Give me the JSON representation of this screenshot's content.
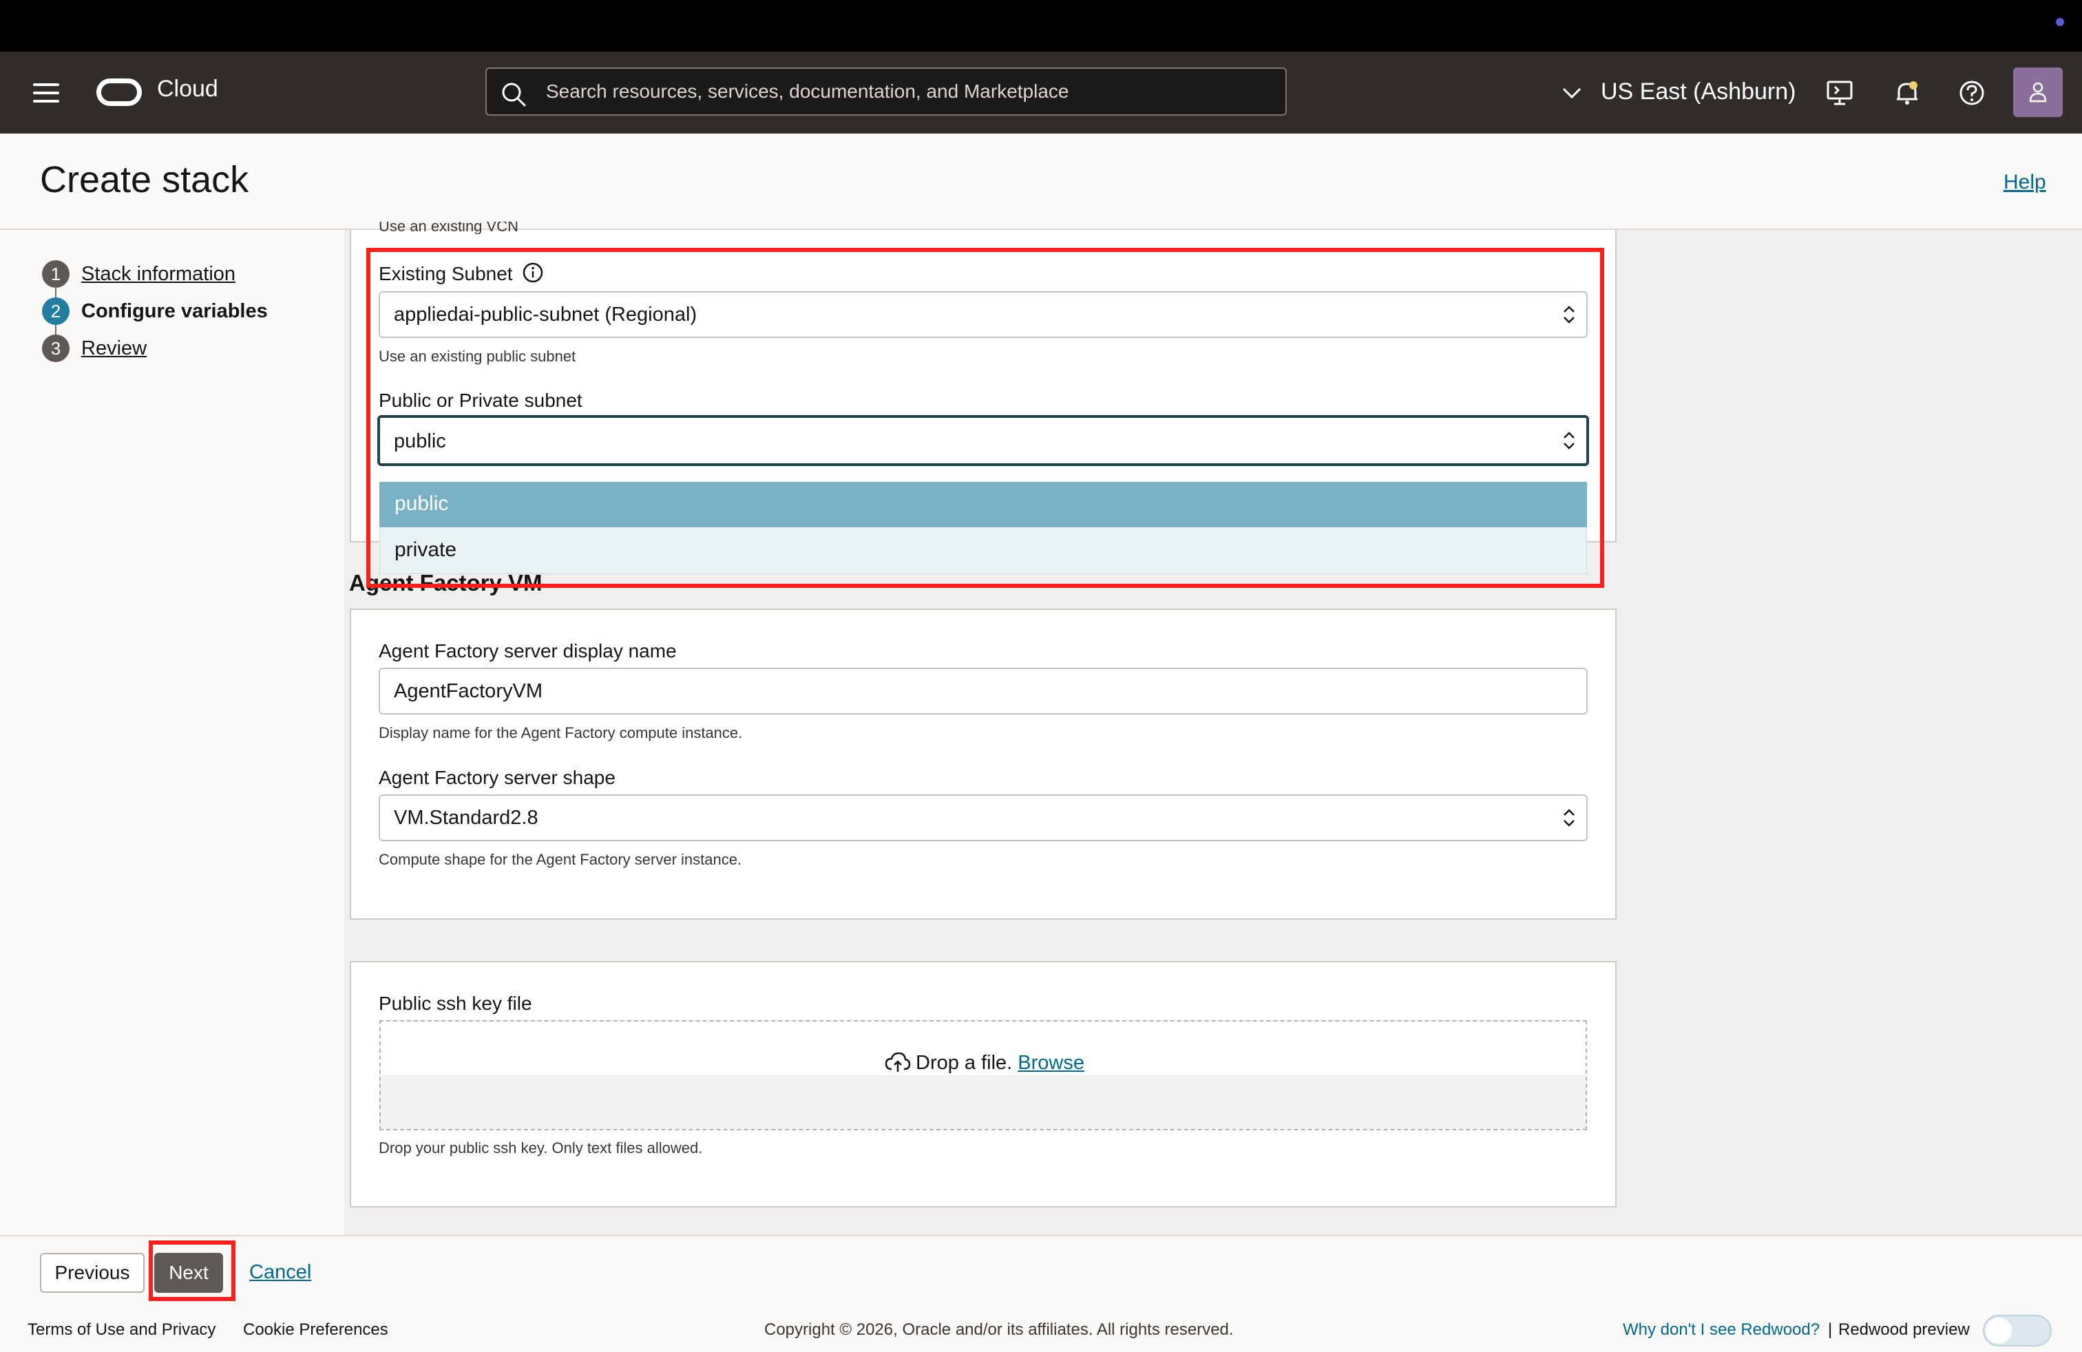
{
  "header": {
    "brand": "Cloud",
    "search_placeholder": "Search resources, services, documentation, and Marketplace",
    "region": "US East (Ashburn)"
  },
  "page": {
    "title": "Create stack",
    "help": "Help"
  },
  "steps": [
    {
      "num": "1",
      "label": "Stack information",
      "state": "done"
    },
    {
      "num": "2",
      "label": "Configure variables",
      "state": "current"
    },
    {
      "num": "3",
      "label": "Review",
      "state": "todo"
    }
  ],
  "network": {
    "vcn_help_cut": "Use an existing VCN",
    "subnet_label": "Existing Subnet",
    "subnet_value": "appliedai-public-subnet (Regional)",
    "subnet_help": "Use an existing public subnet",
    "public_private_label": "Public or Private subnet",
    "public_private_value": "public",
    "options": [
      "public",
      "private"
    ]
  },
  "vm_section": {
    "title": "Agent Factory VM",
    "display_name_label": "Agent Factory server display name",
    "display_name_value": "AgentFactoryVM",
    "display_name_help": "Display name for the Agent Factory compute instance.",
    "shape_label": "Agent Factory server shape",
    "shape_value": "VM.Standard2.8",
    "shape_help": "Compute shape for the Agent Factory server instance."
  },
  "ssh": {
    "label": "Public ssh key file",
    "drop_text": "Drop a file.",
    "browse": "Browse",
    "help": "Drop your public ssh key. Only text files allowed."
  },
  "actions": {
    "previous": "Previous",
    "next": "Next",
    "cancel": "Cancel"
  },
  "footer": {
    "terms": "Terms of Use and Privacy",
    "cookies": "Cookie Preferences",
    "copyright": "Copyright © 2026, Oracle and/or its affiliates. All rights reserved.",
    "redwood_why": "Why don't I see Redwood?",
    "separator": "|",
    "redwood_preview": "Redwood preview"
  },
  "colors": {
    "header_bg": "#312d2a",
    "link": "#00688c",
    "highlight": "#ff1f1a",
    "selected_option": "#7ab1c5"
  }
}
